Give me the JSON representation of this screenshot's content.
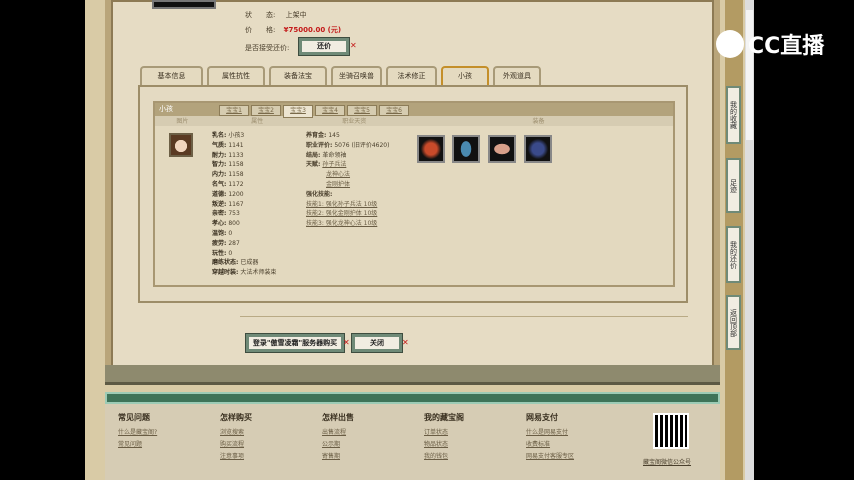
{
  "item": {
    "status_label": "状　　态:",
    "status": "上架中",
    "price_label": "价　　格:",
    "price": "¥75000.00 (元)",
    "counter_label": "是否接受还价:",
    "counter_button": "还价"
  },
  "tabs": [
    "基本信息",
    "属性抗性",
    "装备法宝",
    "坐骑召唤兽",
    "法术修正",
    "小孩",
    "外观道具"
  ],
  "active_tab": "小孩",
  "child": {
    "section": "小孩",
    "subtabs": [
      "宝宝1",
      "宝宝2",
      "宝宝3",
      "宝宝4",
      "宝宝5",
      "宝宝6"
    ],
    "active_subtab": "宝宝3",
    "col_headers": [
      "图片",
      "属性",
      "职业天资",
      "装备"
    ],
    "attrs": [
      [
        "乳名:",
        "小孩3"
      ],
      [
        "气质:",
        "1141"
      ],
      [
        "耐力:",
        "1133"
      ],
      [
        "智力:",
        "1158"
      ],
      [
        "内力:",
        "1158"
      ],
      [
        "名气:",
        "1172"
      ],
      [
        "道德:",
        "1200"
      ],
      [
        "叛逆:",
        "1167"
      ],
      [
        "亲密:",
        "753"
      ],
      [
        "孝心:",
        "800"
      ],
      [
        "温饱:",
        "0"
      ],
      [
        "疲劳:",
        "287"
      ],
      [
        "玩性:",
        "0"
      ],
      [
        "磨练状态:",
        "已成器"
      ],
      [
        "穿越时装:",
        "大法术师装束"
      ]
    ],
    "job": {
      "money_label": "养育金:",
      "money": "145",
      "score_label": "职业评价:",
      "score": "5076 (旧评价4620)",
      "ending_label": "结局:",
      "ending": "革命领袖",
      "talent_label": "天赋:",
      "talents": [
        "孙子兵法",
        "龙神心法",
        "金刚护体"
      ],
      "skills_label": "强化技能:",
      "skills": [
        "技能1: 强化孙子兵法 10级",
        "技能2: 强化金刚护体 10级",
        "技能3: 强化龙神心法 10级"
      ]
    },
    "equipment": [
      "equip-1",
      "equip-2",
      "equip-3",
      "equip-4"
    ]
  },
  "actions": {
    "login_buy": "登录\"傲雪凌霜\"服务器购买",
    "close": "关闭"
  },
  "footer": [
    {
      "title": "常见问题",
      "links": [
        "什么是藏宝阁?",
        "常见问题"
      ]
    },
    {
      "title": "怎样购买",
      "links": [
        "浏览搜索",
        "购买流程",
        "注意事项"
      ]
    },
    {
      "title": "怎样出售",
      "links": [
        "出售流程",
        "公示期",
        "寄售期"
      ]
    },
    {
      "title": "我的藏宝阁",
      "links": [
        "订单状态",
        "物品状态",
        "我的钱包"
      ]
    },
    {
      "title": "网易支付",
      "links": [
        "什么是网易支付",
        "收费标准",
        "网易支付客服专区"
      ]
    }
  ],
  "qr_caption": "藏宝阁微信公众号",
  "sidebar": [
    "我的收藏",
    "足迹",
    "我的还价",
    "返回顶部"
  ],
  "watermark": "CC直播"
}
